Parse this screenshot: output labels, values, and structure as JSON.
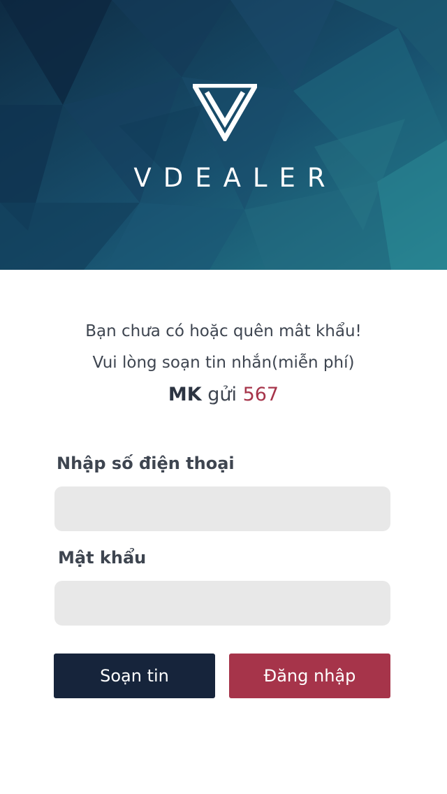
{
  "colors": {
    "hero_dark": "#0f3048",
    "hero_light": "#227a8a",
    "text": "#3e4550",
    "accent": "#a6344a",
    "navy_button": "#16243b",
    "field_bg": "#e8e8e8"
  },
  "header": {
    "logo_icon": "v-triangle-logo-icon",
    "brand": "VDEALER"
  },
  "notice": {
    "line1": "Bạn chưa có hoặc quên mât khẩu!",
    "line2": "Vui lòng soạn tin nhắn(miễn phí)",
    "keyword": "MK",
    "send_word": " gửi ",
    "shortcode": "567"
  },
  "form": {
    "phone_label": "Nhập số điện thoại",
    "phone_value": "",
    "password_label": "Mật khẩu",
    "password_value": ""
  },
  "actions": {
    "sms_label": "Soạn tin",
    "login_label": "Đăng nhập"
  }
}
